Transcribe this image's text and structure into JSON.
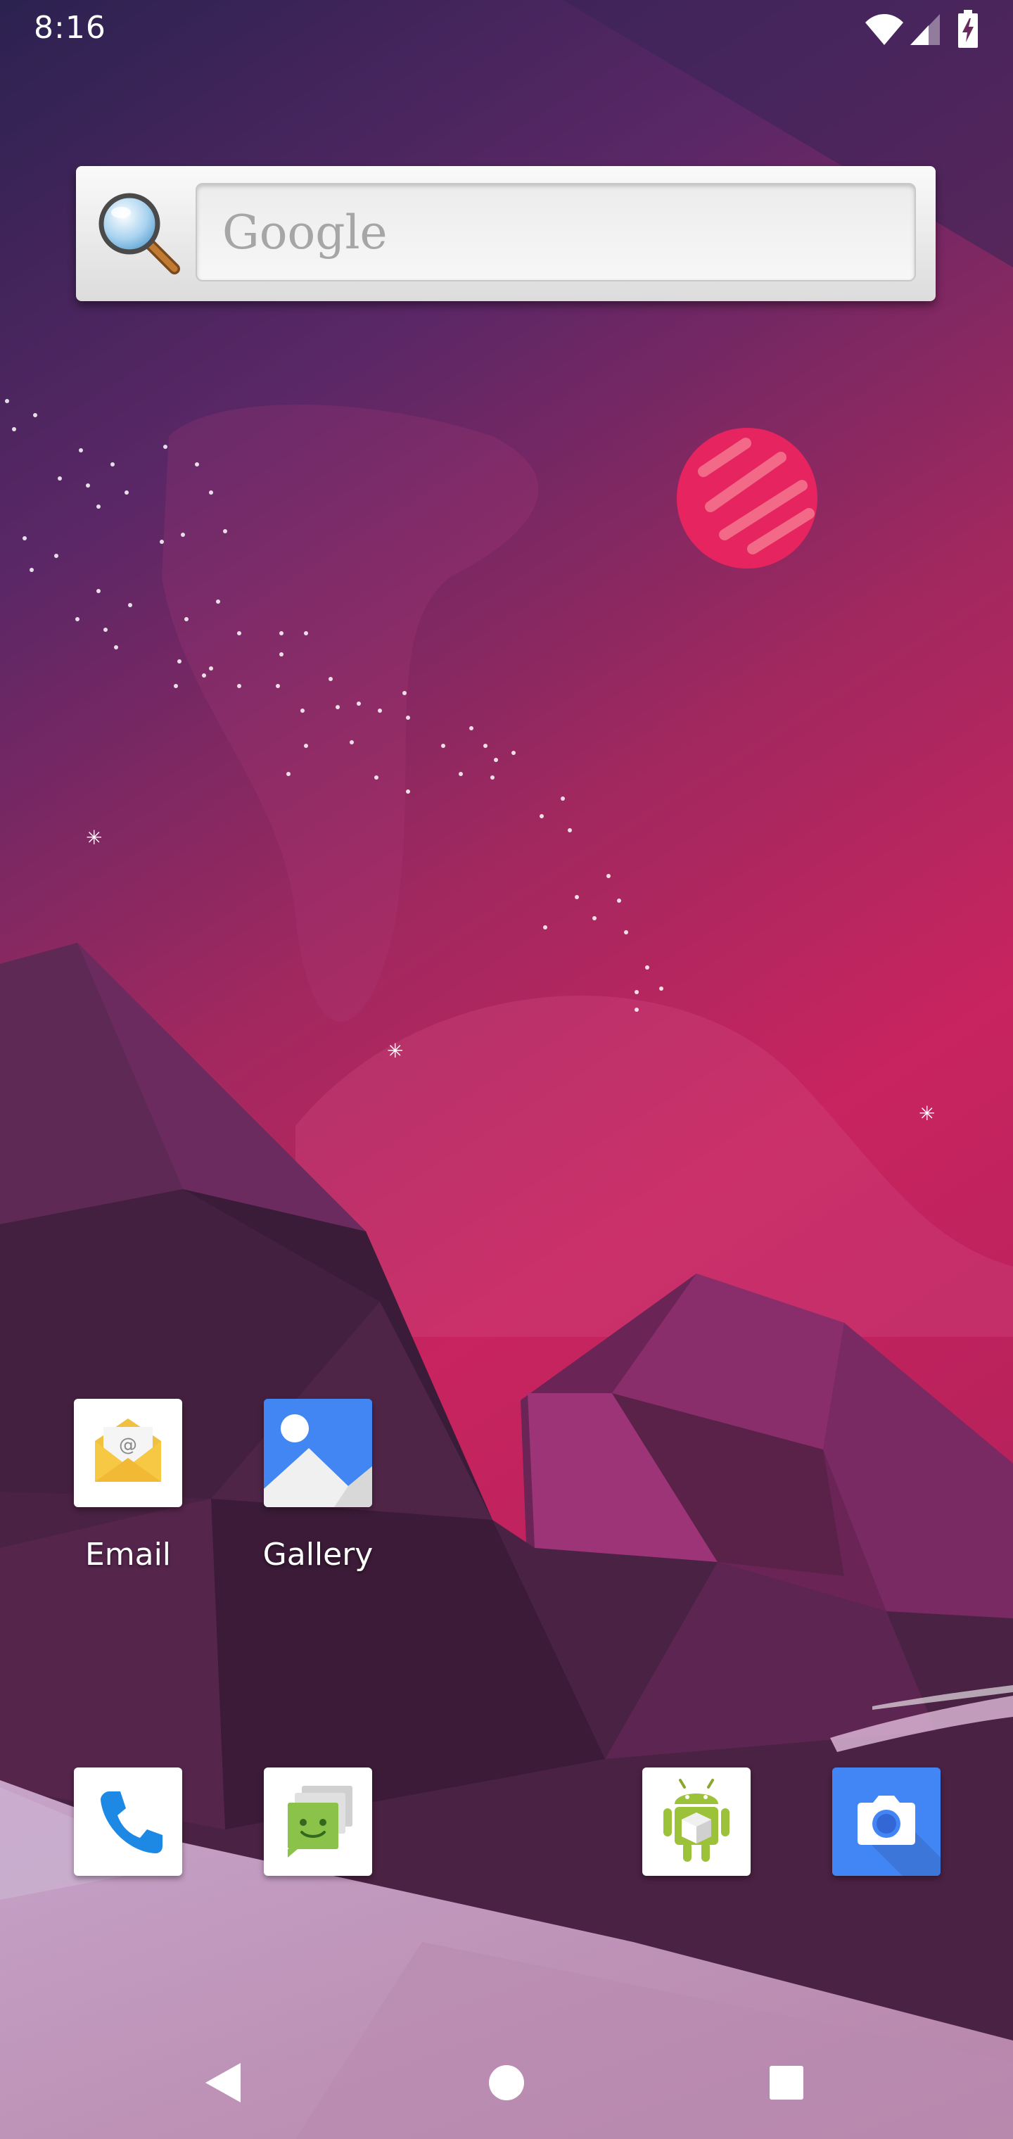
{
  "status_bar": {
    "time": "8:16",
    "icons": [
      "wifi-icon",
      "cellular-signal-icon",
      "battery-charging-icon"
    ]
  },
  "search_widget": {
    "hint": "Google",
    "icon": "magnifier-icon"
  },
  "home_apps": [
    {
      "label": "Email",
      "icon": "email-icon"
    },
    {
      "label": "Gallery",
      "icon": "gallery-icon"
    }
  ],
  "dock_apps": [
    {
      "icon": "phone-icon"
    },
    {
      "icon": "messaging-icon"
    },
    {
      "icon": "android-package-icon"
    },
    {
      "icon": "camera-icon"
    }
  ],
  "nav_bar": {
    "buttons": [
      "back-icon",
      "home-icon",
      "recents-icon"
    ]
  },
  "colors": {
    "sky_top": "#2e2250",
    "sky_bottom": "#c4205d",
    "moon": "#e6245f",
    "phone_blue": "#1e88e5",
    "camera_blue": "#4285f4",
    "messaging_green": "#8bc34a"
  }
}
